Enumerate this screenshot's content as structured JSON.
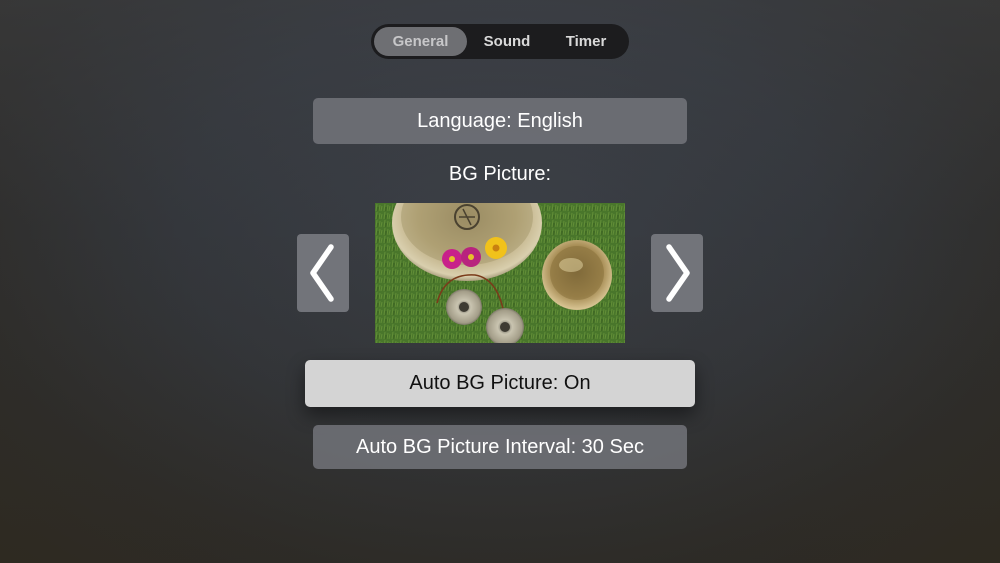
{
  "tabs": [
    {
      "label": "General",
      "active": true
    },
    {
      "label": "Sound",
      "active": false
    },
    {
      "label": "Timer",
      "active": false
    }
  ],
  "language_button": {
    "label": "Language: English"
  },
  "bg_picture": {
    "label": "BG Picture:",
    "prev_icon": "chevron-left-icon",
    "next_icon": "chevron-right-icon"
  },
  "auto_bg_button": {
    "label": "Auto BG Picture: On"
  },
  "interval_button": {
    "label": "Auto BG Picture Interval: 30 Sec"
  },
  "colors": {
    "tab_bar": "#1c1c1e",
    "tab_active": "#6e6f73",
    "button": "#7a7c82",
    "button_focused": "#d4d4d4"
  }
}
